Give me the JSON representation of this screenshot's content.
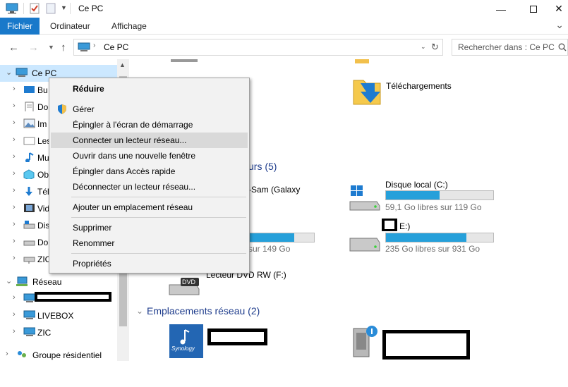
{
  "window": {
    "title": "Ce PC"
  },
  "ribbon": {
    "tabs": [
      "Fichier",
      "Ordinateur",
      "Affichage"
    ]
  },
  "address": {
    "path": "Ce PC",
    "search_placeholder": "Rechercher dans : Ce PC"
  },
  "nav": {
    "items": [
      {
        "label": "Ce PC"
      },
      {
        "label": "Bu"
      },
      {
        "label": "Do"
      },
      {
        "label": "Im"
      },
      {
        "label": "Les"
      },
      {
        "label": "Mu"
      },
      {
        "label": "Ob"
      },
      {
        "label": "Tél"
      },
      {
        "label": "Vid"
      },
      {
        "label": "Dis"
      },
      {
        "label": "Do"
      },
      {
        "label": "ZIC"
      },
      {
        "label": "Réseau"
      },
      {
        "label": ""
      },
      {
        "label": "LIVEBOX"
      },
      {
        "label": "ZIC"
      },
      {
        "label": "Groupe résidentiel"
      }
    ]
  },
  "content": {
    "folders": [
      {
        "label": "Téléchargements"
      }
    ],
    "devices_section": "urs (5)",
    "device_partial": "-Sam (Galaxy",
    "drives": [
      {
        "name": "Disque local (C:)",
        "free": "59,1 Go libres sur 119 Go",
        "used_fraction": 0.5
      },
      {
        "name": "",
        "free": "sur 149 Go",
        "used_fraction": 0.7
      },
      {
        "name": "E:)",
        "free": "235 Go libres sur 931 Go",
        "used_fraction": 0.75
      },
      {
        "name": "Lecteur DVD RW (F:)"
      }
    ],
    "dvd_badge": "DVD",
    "network_section": "Emplacements réseau (2)",
    "synology_label": "Synology"
  },
  "context_menu": {
    "items": [
      "Réduire",
      "Gérer",
      "Épingler à l'écran de démarrage",
      "Connecter un lecteur réseau...",
      "Ouvrir dans une nouvelle fenêtre",
      "Épingler dans Accès rapide",
      "Déconnecter un lecteur réseau...",
      "Ajouter un emplacement réseau",
      "Supprimer",
      "Renommer",
      "Propriétés"
    ]
  }
}
